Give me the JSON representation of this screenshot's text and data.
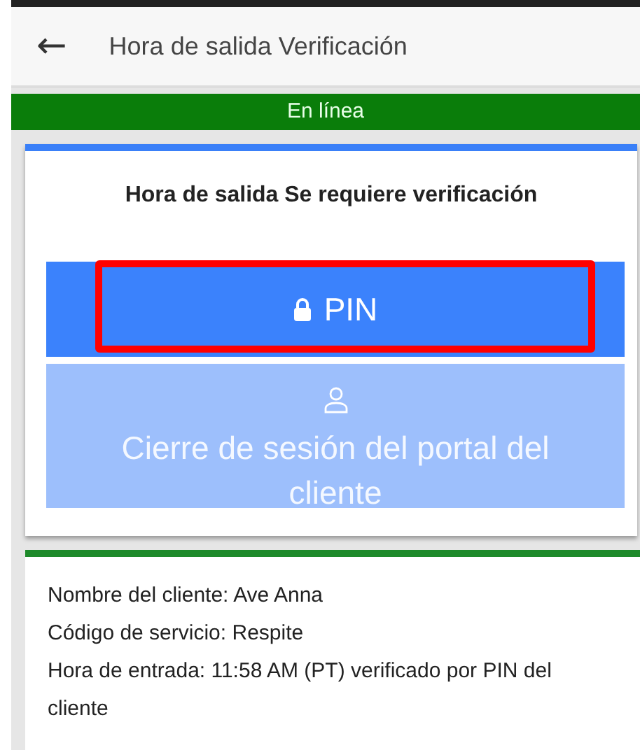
{
  "header": {
    "back_icon": "←",
    "title": "Hora de salida Verificación"
  },
  "status_bar": {
    "text": "En línea"
  },
  "verification_card": {
    "title": "Hora de salida Se requiere verificación",
    "buttons": [
      {
        "kind": "pin",
        "label": "PIN",
        "disabled": false,
        "highlighted": true
      },
      {
        "kind": "portal",
        "label": "Cierre de sesión del portal del cliente",
        "disabled": true,
        "highlighted": false
      }
    ]
  },
  "info_card": {
    "lines": [
      "Nombre del cliente: Ave Anna",
      "Código de servicio: Respite",
      "Hora de entrada: 11:58 AM (PT) verificado por PIN del cliente"
    ]
  }
}
